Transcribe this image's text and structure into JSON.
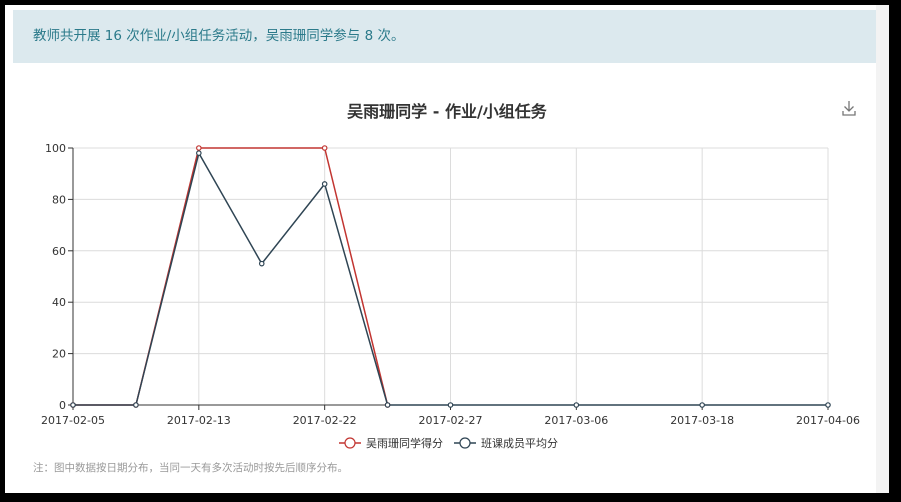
{
  "banner": {
    "text": "教师共开展 16 次作业/小组任务活动，吴雨珊同学参与 8 次。"
  },
  "note": "注：图中数据按日期分布，当同一天有多次活动时按先后顺序分布。",
  "icons": {
    "download": "download-icon"
  },
  "colors": {
    "student": "#c23531",
    "average": "#2f4554",
    "banner_bg": "#dce9ee",
    "banner_text": "#2b7a8a"
  },
  "chart_data": {
    "type": "line",
    "title": "吴雨珊同学 - 作业/小组任务",
    "xlabel": "",
    "ylabel": "",
    "ylim": [
      0,
      100
    ],
    "yticks": [
      0,
      20,
      40,
      60,
      80,
      100
    ],
    "x_tick_labels": [
      "2017-02-05",
      "2017-02-13",
      "2017-02-22",
      "2017-02-27",
      "2017-03-06",
      "2017-03-18",
      "2017-04-06"
    ],
    "points_per_tick": 2,
    "grid": true,
    "legend_position": "bottom",
    "series": [
      {
        "name": "吴雨珊同学得分",
        "color": "#c23531",
        "values": [
          0,
          0,
          100,
          null,
          100,
          0,
          null,
          null,
          null,
          null,
          null,
          null,
          null
        ]
      },
      {
        "name": "班课成员平均分",
        "color": "#2f4554",
        "values": [
          0,
          0,
          98,
          55,
          86,
          0,
          0,
          null,
          0,
          null,
          0,
          null,
          0
        ]
      }
    ]
  }
}
